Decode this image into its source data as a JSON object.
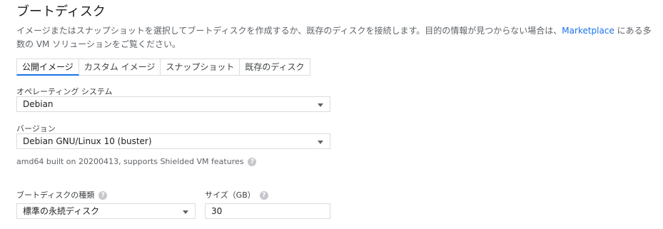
{
  "section_title": "ブートディスク",
  "description": {
    "text_before": "イメージまたはスナップショットを選択してブートディスクを作成するか、既存のディスクを接続します。目的の情報が見つからない場合は、",
    "link": "Marketplace",
    "text_after": " にある多数の VM ソリューションをご覧ください。"
  },
  "tabs": [
    "公開イメージ",
    "カスタム イメージ",
    "スナップショット",
    "既存のディスク"
  ],
  "os": {
    "label": "オペレーティング システム",
    "value": "Debian"
  },
  "version": {
    "label": "バージョン",
    "value": "Debian GNU/Linux 10 (buster)",
    "note": "amd64 built on 20200413, supports Shielded VM features"
  },
  "disk_type": {
    "label": "ブートディスクの種類",
    "value": "標準の永続ディスク"
  },
  "size": {
    "label": "サイズ（GB）",
    "value": "30"
  },
  "colors": {
    "accent": "#1a73e8",
    "border": "#dadce0",
    "muted": "#5f6368"
  },
  "icons": {
    "help": "help-circle-icon",
    "dropdown": "dropdown-arrow-icon"
  }
}
